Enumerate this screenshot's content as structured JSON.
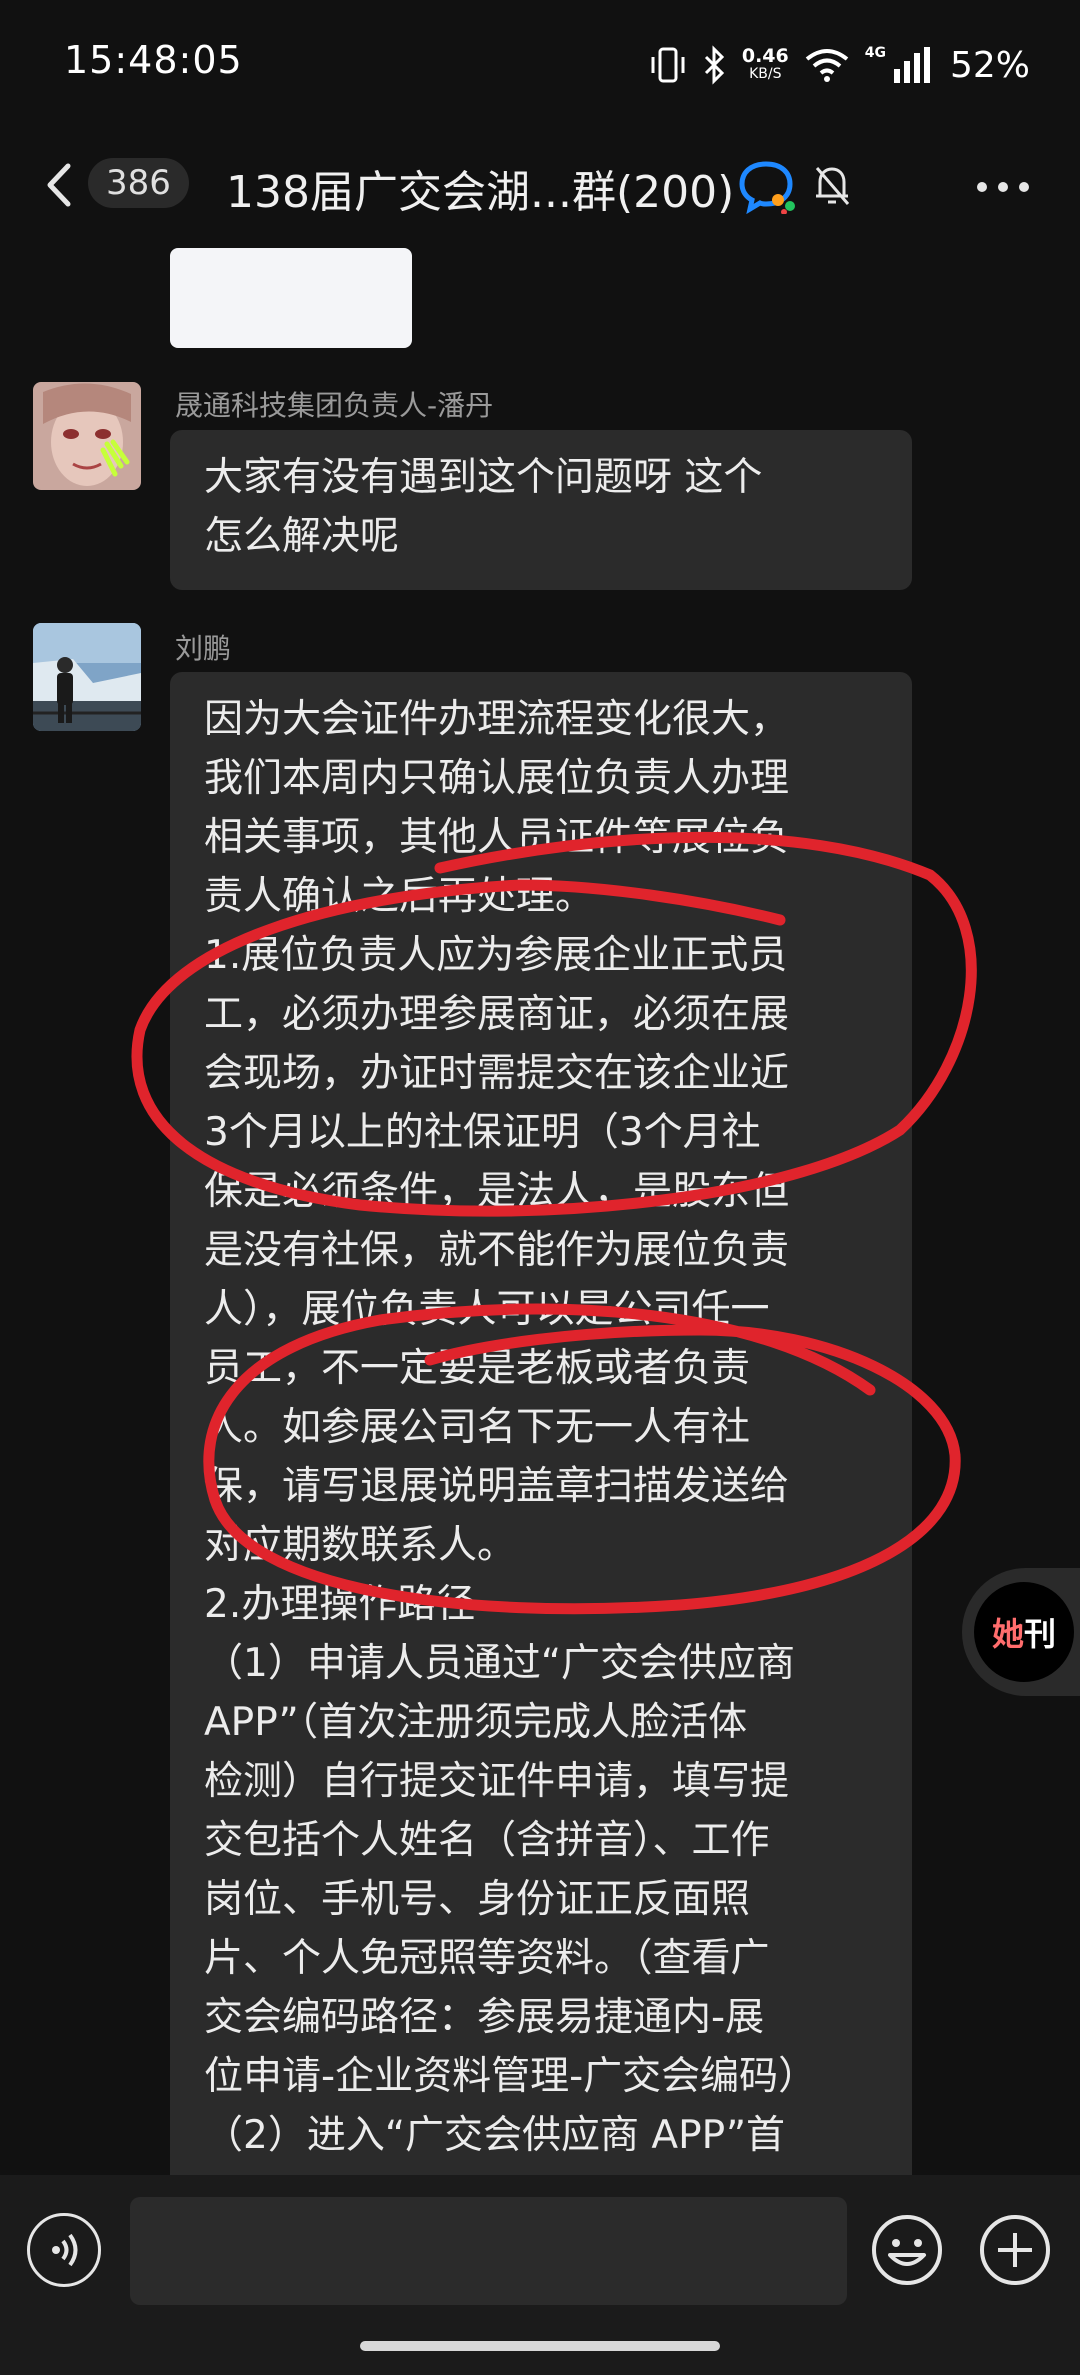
{
  "status_bar": {
    "time": "15:48:05",
    "net_speed": "0.46",
    "net_unit": "KB/S",
    "network": "4G",
    "battery": "52%"
  },
  "header": {
    "unread_count": "386",
    "title": "138届广交会湖...群(200)"
  },
  "messages": [
    {
      "sender": "晟通科技集团负责人-潘丹",
      "text": "大家有没有遇到这个问题呀 这个\n怎么解决呢"
    },
    {
      "sender": "刘鹏",
      "text": "因为大会证件办理流程变化很大，\n我们本周内只确认展位负责人办理\n相关事项，其他人员证件等展位负\n责人确认之后再处理。\n1.展位负责人应为参展企业正式员\n工，必须办理参展商证，必须在展\n会现场，办证时需提交在该企业近\n3个月以上的社保证明（3个月社\n保是必须条件，是法人，是股东但\n是没有社保，就不能作为展位负责\n人），展位负责人可以是公司任一\n员工，不一定要是老板或者负责\n人。如参展公司名下无一人有社\n保，请写退展说明盖章扫描发送给\n对应期数联系人。\n2.办理操作路径\n（1）申请人员通过“广交会供应商\nAPP”（首次注册须完成人脸活体\n检测）自行提交证件申请，填写提\n交包括个人姓名（含拼音）、工作\n岗位、手机号、身份证正反面照\n片、个人免冠照等资料。（查看广\n交会编码路径：参展易捷通内-展\n位申请-企业资料管理-广交会编码）\n（2）进入“广交会供应商 APP”首"
    }
  ],
  "floating_badge": {
    "logo_part1": "她",
    "logo_part2": "刊"
  },
  "colors": {
    "background": "#111111",
    "bubble": "#2b2b2b",
    "annotation_red": "#e0242c"
  },
  "icons": [
    "back-arrow-icon",
    "group-chat-icon",
    "mute-bell-icon",
    "more-icon",
    "voice-icon",
    "emoji-icon",
    "plus-icon"
  ]
}
